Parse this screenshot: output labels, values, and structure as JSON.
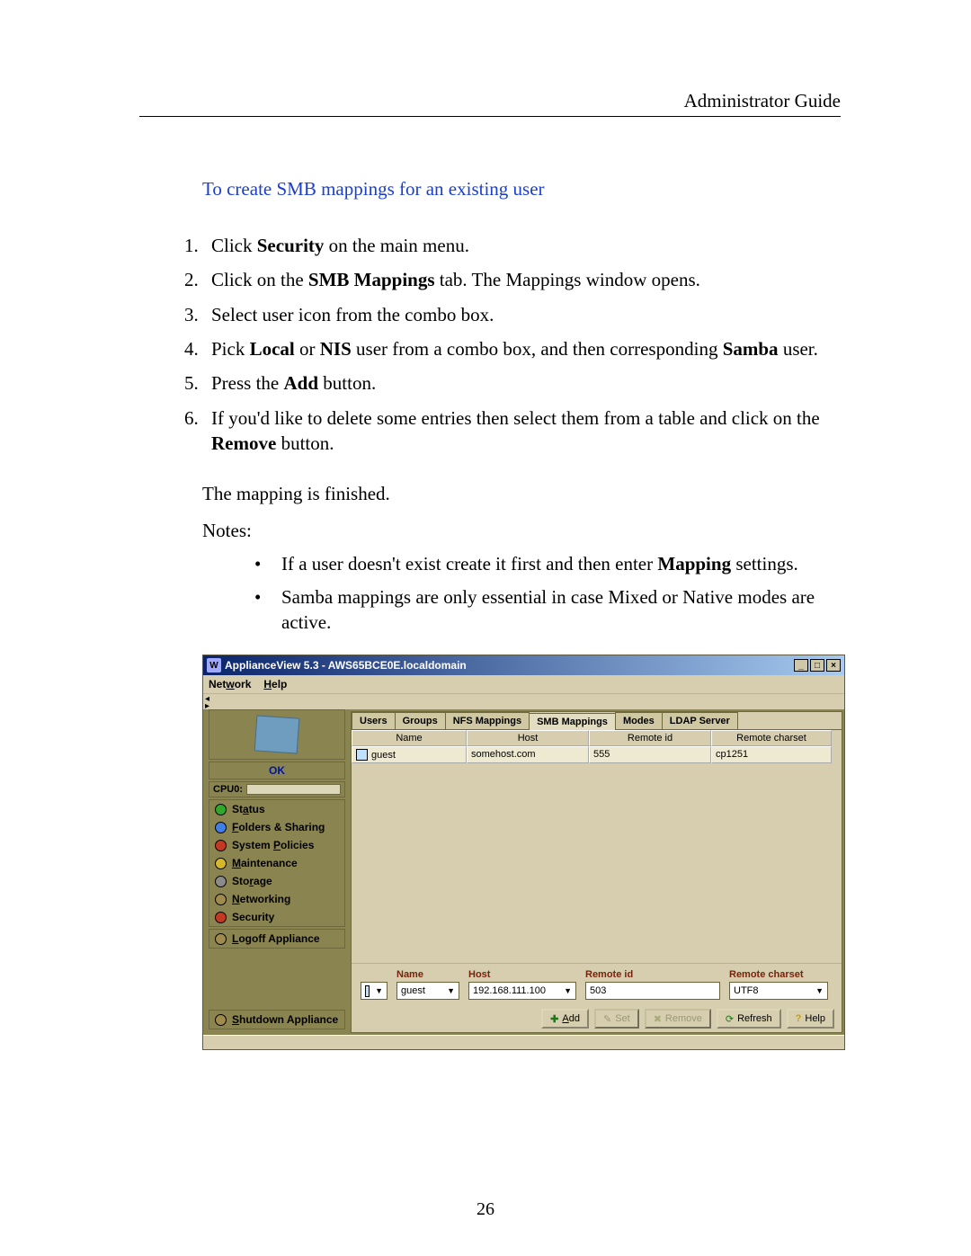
{
  "header": {
    "title": "Administrator Guide"
  },
  "section_title": "To create SMB mappings for an existing user",
  "steps": [
    {
      "n": "1.",
      "pre": "Click ",
      "b1": "Security",
      "mid": " on the main menu."
    },
    {
      "n": "2.",
      "pre": "Click on the ",
      "b1": "SMB Mappings",
      "mid": " tab. The Mappings window opens."
    },
    {
      "n": "3.",
      "pre": "Select user icon from the combo box."
    },
    {
      "n": "4.",
      "pre": "Pick ",
      "b1": "Local",
      "mid": " or ",
      "b2": "NIS",
      "mid2": " user from a combo box, and then corresponding ",
      "b3": "Samba",
      "post": " user."
    },
    {
      "n": "5.",
      "pre": "Press the ",
      "b1": "Add",
      "mid": " button."
    },
    {
      "n": "6.",
      "pre": "If you'd like to delete some entries then select them from a table and click on the ",
      "b1": "Remove",
      "mid": " button."
    }
  ],
  "para_finished": "The mapping is finished.",
  "notes_label": "Notes:",
  "notes": [
    {
      "pre": "If a user doesn't exist create it first and then enter ",
      "b1": "Mapping",
      "post": " settings."
    },
    {
      "pre": "Samba mappings are only essential in case Mixed or Native modes are active."
    }
  ],
  "page_number": "26",
  "app": {
    "title": "ApplianceView 5.3 - AWS65BCE0E.localdomain",
    "title_icon_letter": "W",
    "menu": {
      "network": "Network",
      "help": "Help",
      "network_u": "w",
      "help_u": "H"
    },
    "sidebar": {
      "ok": "OK",
      "cpu_label": "CPU0:",
      "items": [
        {
          "label": "Status",
          "u": "a",
          "color": "dot-green"
        },
        {
          "label": "Folders & Sharing",
          "u": "F",
          "color": "dot-blue"
        },
        {
          "label": "System Policies",
          "u": "P",
          "color": "dot-red"
        },
        {
          "label": "Maintenance",
          "u": "M",
          "color": "dot-yellow"
        },
        {
          "label": "Storage",
          "u": "r",
          "color": "dot-gray"
        },
        {
          "label": "Networking",
          "u": "N",
          "color": "dot-brown"
        },
        {
          "label": "Security",
          "u": "",
          "color": "dot-red"
        }
      ],
      "logoff": "Logoff Appliance",
      "logoff_u": "L",
      "shutdown": "Shutdown Appliance",
      "shutdown_u": "S"
    },
    "tabs": [
      "Users",
      "Groups",
      "NFS Mappings",
      "SMB Mappings",
      "Modes",
      "LDAP Server"
    ],
    "active_tab": 3,
    "table": {
      "headers": [
        "Name",
        "Host",
        "Remote id",
        "Remote charset"
      ],
      "rows": [
        {
          "name": "guest",
          "host": "somehost.com",
          "remoteid": "555",
          "charset": "cp1251"
        }
      ]
    },
    "form": {
      "name_label": "Name",
      "host_label": "Host",
      "remoteid_label": "Remote id",
      "charset_label": "Remote charset",
      "name_value": "guest",
      "host_value": "192.168.111.100",
      "remoteid_value": "503",
      "charset_value": "UTF8"
    },
    "buttons": {
      "add": "Add",
      "set": "Set",
      "remove": "Remove",
      "refresh": "Refresh",
      "help": "Help"
    }
  }
}
